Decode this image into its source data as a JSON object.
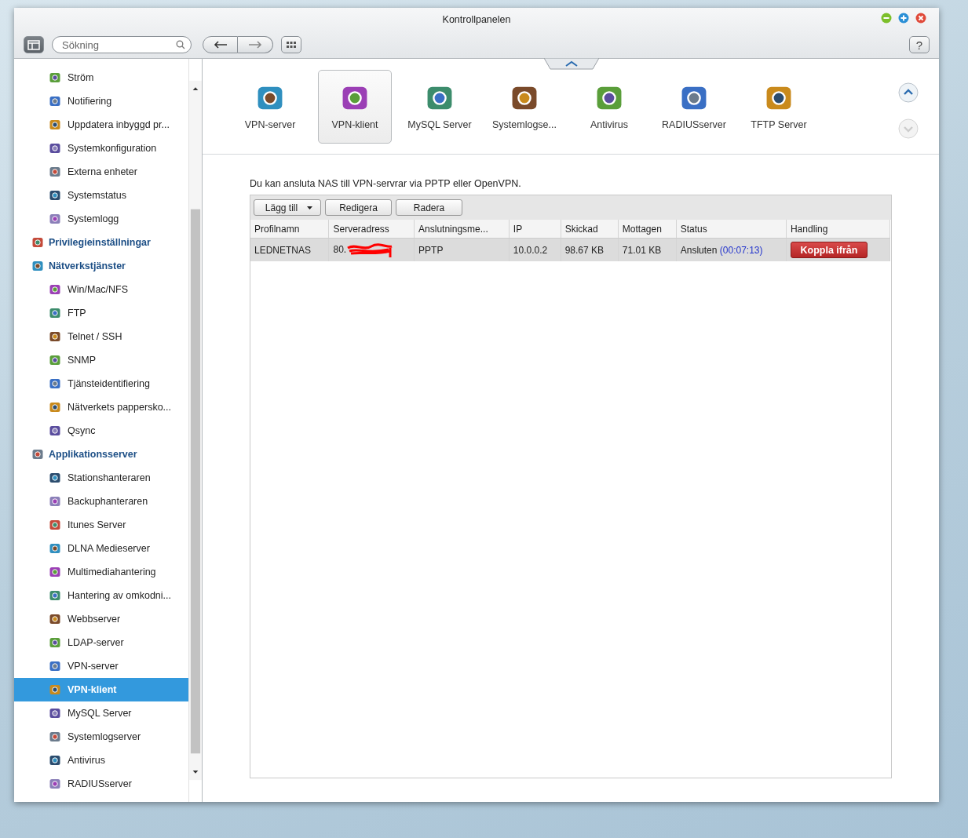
{
  "window": {
    "title": "Kontrollpanelen"
  },
  "toolbar": {
    "search": {
      "placeholder": "Sökning"
    },
    "help": "?"
  },
  "sidebar": {
    "groups": [
      {
        "children": [
          {
            "label": "Ström",
            "selected": false
          },
          {
            "label": "Notifiering",
            "selected": false
          },
          {
            "label": "Uppdatera inbyggd pr...",
            "selected": false
          },
          {
            "label": "Systemkonfiguration",
            "selected": false
          },
          {
            "label": "Externa enheter",
            "selected": false
          },
          {
            "label": "Systemstatus",
            "selected": false
          },
          {
            "label": "Systemlogg",
            "selected": false
          }
        ]
      },
      {
        "label": "Privilegieinställningar"
      },
      {
        "label": "Nätverkstjänster",
        "children": [
          {
            "label": "Win/Mac/NFS",
            "selected": false
          },
          {
            "label": "FTP",
            "selected": false
          },
          {
            "label": "Telnet / SSH",
            "selected": false
          },
          {
            "label": "SNMP",
            "selected": false
          },
          {
            "label": "Tjänsteidentifiering",
            "selected": false
          },
          {
            "label": "Nätverkets pappersko...",
            "selected": false
          },
          {
            "label": "Qsync",
            "selected": false
          }
        ]
      },
      {
        "label": "Applikationsserver",
        "children": [
          {
            "label": "Stationshanteraren",
            "selected": false
          },
          {
            "label": "Backuphanteraren",
            "selected": false
          },
          {
            "label": "Itunes Server",
            "selected": false
          },
          {
            "label": "DLNA Medieserver",
            "selected": false
          },
          {
            "label": "Multimediahantering",
            "selected": false
          },
          {
            "label": "Hantering av omkodni...",
            "selected": false
          },
          {
            "label": "Webbserver",
            "selected": false
          },
          {
            "label": "LDAP-server",
            "selected": false
          },
          {
            "label": "VPN-server",
            "selected": false
          },
          {
            "label": "VPN-klient",
            "selected": true
          },
          {
            "label": "MySQL Server",
            "selected": false
          },
          {
            "label": "Systemlogserver",
            "selected": false
          },
          {
            "label": "Antivirus",
            "selected": false
          },
          {
            "label": "RADIUSserver",
            "selected": false
          }
        ]
      }
    ]
  },
  "app_bar": [
    {
      "label": "VPN-server",
      "selected": false
    },
    {
      "label": "VPN-klient",
      "selected": true
    },
    {
      "label": "MySQL Server",
      "selected": false
    },
    {
      "label": "Systemlogse...",
      "selected": false
    },
    {
      "label": "Antivirus",
      "selected": false
    },
    {
      "label": "RADIUSserver",
      "selected": false
    },
    {
      "label": "TFTP Server",
      "selected": false
    }
  ],
  "content": {
    "description": "Du kan ansluta NAS till VPN-servrar via PPTP eller OpenVPN.",
    "buttons": [
      {
        "label": "Lägg till",
        "dropdown": true
      },
      {
        "label": "Redigera",
        "dropdown": false
      },
      {
        "label": "Radera",
        "dropdown": false
      }
    ],
    "table": {
      "columns": [
        "Profilnamn",
        "Serveradress",
        "Anslutningsme...",
        "IP",
        "Skickad",
        "Mottagen",
        "Status",
        "Handling"
      ],
      "rows": [
        {
          "selected": true,
          "profile": "LEDNETNAS",
          "server": "80.",
          "method": "PPTP",
          "ip": "10.0.0.2",
          "sent": "98.67 KB",
          "received": "71.01 KB",
          "status": "Ansluten",
          "duration": "(00:07:13)",
          "action": "Koppla ifrån"
        }
      ]
    }
  }
}
